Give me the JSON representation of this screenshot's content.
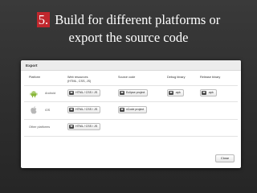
{
  "slide": {
    "number": "5.",
    "title_line1": "Build for different platforms or",
    "title_line2": "export the source code"
  },
  "dialog": {
    "title": "Export",
    "headers": {
      "platform": "Platform",
      "web_line1": "Web resources",
      "web_line2": "(HTML, CSS, JS)",
      "source": "Source code",
      "debug": "Debug binary",
      "release": "Release binary"
    },
    "rows": [
      {
        "platform": "Android",
        "web": "HTML / CSS / JS",
        "source": "Eclipse project",
        "debug": ".apk",
        "release": ".apk"
      },
      {
        "platform": "iOS",
        "web": "HTML / CSS / JS",
        "source": "xCode project"
      },
      {
        "platform": "Other platforms",
        "web": "HTML / CSS / JS"
      }
    ],
    "close_label": "Close"
  },
  "colors": {
    "accent_red": "#c0272d",
    "android_green": "#8ab83a",
    "background": "#2e2e2e"
  },
  "icons": {
    "android": "android-icon",
    "ios": "apple-icon",
    "download": "download-icon"
  }
}
